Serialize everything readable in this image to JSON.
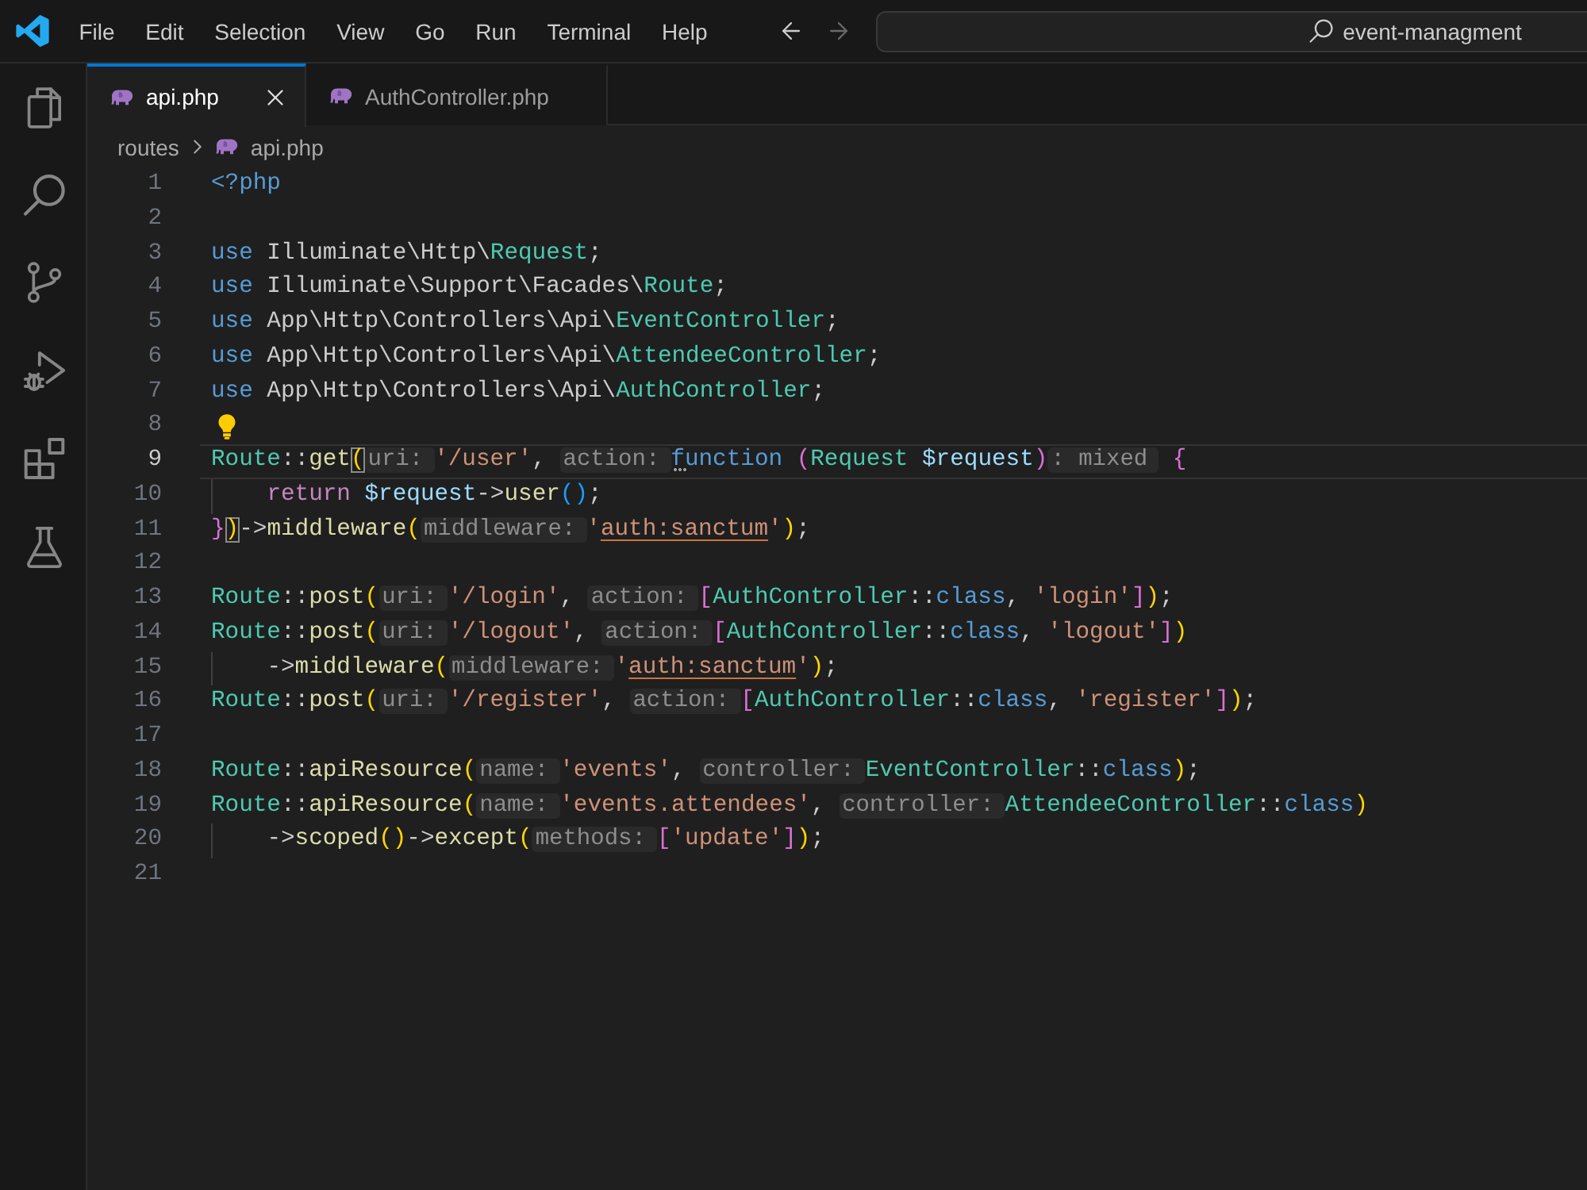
{
  "title_bar": {
    "menus": [
      "File",
      "Edit",
      "Selection",
      "View",
      "Go",
      "Run",
      "Terminal",
      "Help"
    ],
    "navigation": [
      {
        "kind": "back",
        "disabled": false
      },
      {
        "kind": "forward",
        "disabled": true
      }
    ],
    "command_center": {
      "text": "event-managment"
    }
  },
  "activity_bar": [
    {
      "kind": "explorer",
      "selected": false
    },
    {
      "kind": "search",
      "selected": false
    },
    {
      "kind": "source_control",
      "selected": false
    },
    {
      "kind": "run_debug",
      "selected": false
    },
    {
      "kind": "extensions",
      "selected": false
    },
    {
      "kind": "testing",
      "selected": false
    }
  ],
  "tabs": [
    {
      "label": "api.php",
      "selected": true
    },
    {
      "label": "AuthController.php",
      "selected": false
    }
  ],
  "breadcrumb": [
    {
      "label": "routes",
      "kind": "folder"
    },
    {
      "label": "api.php",
      "kind": "file"
    }
  ],
  "editor": {
    "lines": [
      {
        "number": "1",
        "current": false,
        "indented": false,
        "tokens": [
          {
            "kind": "keyword",
            "text": "<?php"
          }
        ]
      },
      {
        "number": "2",
        "current": false,
        "indented": false
      },
      {
        "number": "3",
        "current": false,
        "indented": false,
        "tokens": [
          {
            "kind": "keyword",
            "text": "use"
          },
          {
            "kind": "plain",
            "text": " Illuminate\\Http\\"
          },
          {
            "kind": "type",
            "text": "Request"
          },
          {
            "kind": "plain",
            "text": ";"
          }
        ]
      },
      {
        "number": "4",
        "current": false,
        "indented": false,
        "tokens": [
          {
            "kind": "keyword",
            "text": "use"
          },
          {
            "kind": "plain",
            "text": " Illuminate\\Support\\Facades\\"
          },
          {
            "kind": "type",
            "text": "Route"
          },
          {
            "kind": "plain",
            "text": ";"
          }
        ]
      },
      {
        "number": "5",
        "current": false,
        "indented": false,
        "tokens": [
          {
            "kind": "keyword",
            "text": "use"
          },
          {
            "kind": "plain",
            "text": " App\\Http\\Controllers\\Api\\"
          },
          {
            "kind": "type",
            "text": "EventController"
          },
          {
            "kind": "plain",
            "text": ";"
          }
        ]
      },
      {
        "number": "6",
        "current": false,
        "indented": false,
        "tokens": [
          {
            "kind": "keyword",
            "text": "use"
          },
          {
            "kind": "plain",
            "text": " App\\Http\\Controllers\\Api\\"
          },
          {
            "kind": "type",
            "text": "AttendeeController"
          },
          {
            "kind": "plain",
            "text": ";"
          }
        ]
      },
      {
        "number": "7",
        "current": false,
        "indented": false,
        "tokens": [
          {
            "kind": "keyword",
            "text": "use"
          },
          {
            "kind": "plain",
            "text": " App\\Http\\Controllers\\Api\\"
          },
          {
            "kind": "type",
            "text": "AuthController"
          },
          {
            "kind": "plain",
            "text": ";"
          }
        ]
      },
      {
        "number": "8",
        "current": false,
        "indented": false,
        "tokens": [
          {
            "kind": "lightbulb"
          }
        ]
      },
      {
        "number": "9",
        "current": true,
        "indented": false,
        "tokens": [
          {
            "kind": "type",
            "text": "Route"
          },
          {
            "kind": "plain",
            "text": "::"
          },
          {
            "kind": "method",
            "text": "get"
          },
          {
            "kind": "matched",
            "text": "("
          },
          {
            "kind": "hint",
            "text": "uri:"
          },
          {
            "kind": "string",
            "text": "'/user'"
          },
          {
            "kind": "plain",
            "text": ", "
          },
          {
            "kind": "hint",
            "text": "action:"
          },
          {
            "kind": "hinted",
            "text": "function"
          },
          {
            "kind": "bracket2",
            "text": " ("
          },
          {
            "kind": "type",
            "text": "Request"
          },
          {
            "kind": "variable",
            "text": " $request"
          },
          {
            "kind": "bracket2",
            "text": ")"
          },
          {
            "kind": "hint",
            "text": ": mixed"
          },
          {
            "kind": "bracket2",
            "text": " {"
          }
        ]
      },
      {
        "number": "10",
        "current": false,
        "indented": true,
        "tokens": [
          {
            "kind": "control",
            "text": "return"
          },
          {
            "kind": "variable",
            "text": " $request"
          },
          {
            "kind": "plain",
            "text": "->"
          },
          {
            "kind": "method",
            "text": "user"
          },
          {
            "kind": "bracket3",
            "text": "()"
          },
          {
            "kind": "plain",
            "text": ";"
          }
        ]
      },
      {
        "number": "11",
        "current": false,
        "indented": false,
        "tokens": [
          {
            "kind": "bracket2",
            "text": "}"
          },
          {
            "kind": "matched",
            "text": ")"
          },
          {
            "kind": "plain",
            "text": "->"
          },
          {
            "kind": "method",
            "text": "middleware"
          },
          {
            "kind": "bracket1",
            "text": "("
          },
          {
            "kind": "hint",
            "text": "middleware:"
          },
          {
            "kind": "string",
            "text": "'"
          },
          {
            "kind": "link",
            "text": "auth:sanctum"
          },
          {
            "kind": "string",
            "text": "'"
          },
          {
            "kind": "bracket1",
            "text": ")"
          },
          {
            "kind": "plain",
            "text": ";"
          }
        ]
      },
      {
        "number": "12",
        "current": false,
        "indented": false
      },
      {
        "number": "13",
        "current": false,
        "indented": false,
        "tokens": [
          {
            "kind": "type",
            "text": "Route"
          },
          {
            "kind": "plain",
            "text": "::"
          },
          {
            "kind": "method",
            "text": "post"
          },
          {
            "kind": "bracket1",
            "text": "("
          },
          {
            "kind": "hint",
            "text": "uri:"
          },
          {
            "kind": "string",
            "text": "'/login'"
          },
          {
            "kind": "plain",
            "text": ", "
          },
          {
            "kind": "hint",
            "text": "action:"
          },
          {
            "kind": "bracket2",
            "text": "["
          },
          {
            "kind": "type",
            "text": "AuthController"
          },
          {
            "kind": "plain",
            "text": "::"
          },
          {
            "kind": "keyword",
            "text": "class"
          },
          {
            "kind": "plain",
            "text": ", "
          },
          {
            "kind": "string",
            "text": "'login'"
          },
          {
            "kind": "bracket2",
            "text": "]"
          },
          {
            "kind": "bracket1",
            "text": ")"
          },
          {
            "kind": "plain",
            "text": ";"
          }
        ]
      },
      {
        "number": "14",
        "current": false,
        "indented": false,
        "tokens": [
          {
            "kind": "type",
            "text": "Route"
          },
          {
            "kind": "plain",
            "text": "::"
          },
          {
            "kind": "method",
            "text": "post"
          },
          {
            "kind": "bracket1",
            "text": "("
          },
          {
            "kind": "hint",
            "text": "uri:"
          },
          {
            "kind": "string",
            "text": "'/logout'"
          },
          {
            "kind": "plain",
            "text": ", "
          },
          {
            "kind": "hint",
            "text": "action:"
          },
          {
            "kind": "bracket2",
            "text": "["
          },
          {
            "kind": "type",
            "text": "AuthController"
          },
          {
            "kind": "plain",
            "text": "::"
          },
          {
            "kind": "keyword",
            "text": "class"
          },
          {
            "kind": "plain",
            "text": ", "
          },
          {
            "kind": "string",
            "text": "'logout'"
          },
          {
            "kind": "bracket2",
            "text": "]"
          },
          {
            "kind": "bracket1",
            "text": ")"
          }
        ]
      },
      {
        "number": "15",
        "current": false,
        "indented": true,
        "tokens": [
          {
            "kind": "plain",
            "text": "->"
          },
          {
            "kind": "method",
            "text": "middleware"
          },
          {
            "kind": "bracket1",
            "text": "("
          },
          {
            "kind": "hint",
            "text": "middleware:"
          },
          {
            "kind": "string",
            "text": "'"
          },
          {
            "kind": "link",
            "text": "auth:sanctum"
          },
          {
            "kind": "string",
            "text": "'"
          },
          {
            "kind": "bracket1",
            "text": ")"
          },
          {
            "kind": "plain",
            "text": ";"
          }
        ]
      },
      {
        "number": "16",
        "current": false,
        "indented": false,
        "tokens": [
          {
            "kind": "type",
            "text": "Route"
          },
          {
            "kind": "plain",
            "text": "::"
          },
          {
            "kind": "method",
            "text": "post"
          },
          {
            "kind": "bracket1",
            "text": "("
          },
          {
            "kind": "hint",
            "text": "uri:"
          },
          {
            "kind": "string",
            "text": "'/register'"
          },
          {
            "kind": "plain",
            "text": ", "
          },
          {
            "kind": "hint",
            "text": "action:"
          },
          {
            "kind": "bracket2",
            "text": "["
          },
          {
            "kind": "type",
            "text": "AuthController"
          },
          {
            "kind": "plain",
            "text": "::"
          },
          {
            "kind": "keyword",
            "text": "class"
          },
          {
            "kind": "plain",
            "text": ", "
          },
          {
            "kind": "string",
            "text": "'register'"
          },
          {
            "kind": "bracket2",
            "text": "]"
          },
          {
            "kind": "bracket1",
            "text": ")"
          },
          {
            "kind": "plain",
            "text": ";"
          }
        ]
      },
      {
        "number": "17",
        "current": false,
        "indented": false
      },
      {
        "number": "18",
        "current": false,
        "indented": false,
        "tokens": [
          {
            "kind": "type",
            "text": "Route"
          },
          {
            "kind": "plain",
            "text": "::"
          },
          {
            "kind": "method",
            "text": "apiResource"
          },
          {
            "kind": "bracket1",
            "text": "("
          },
          {
            "kind": "hint",
            "text": "name:"
          },
          {
            "kind": "string",
            "text": "'events'"
          },
          {
            "kind": "plain",
            "text": ", "
          },
          {
            "kind": "hint",
            "text": "controller:"
          },
          {
            "kind": "type",
            "text": "EventController"
          },
          {
            "kind": "plain",
            "text": "::"
          },
          {
            "kind": "keyword",
            "text": "class"
          },
          {
            "kind": "bracket1",
            "text": ")"
          },
          {
            "kind": "plain",
            "text": ";"
          }
        ]
      },
      {
        "number": "19",
        "current": false,
        "indented": false,
        "tokens": [
          {
            "kind": "type",
            "text": "Route"
          },
          {
            "kind": "plain",
            "text": "::"
          },
          {
            "kind": "method",
            "text": "apiResource"
          },
          {
            "kind": "bracket1",
            "text": "("
          },
          {
            "kind": "hint",
            "text": "name:"
          },
          {
            "kind": "string",
            "text": "'events.attendees'"
          },
          {
            "kind": "plain",
            "text": ", "
          },
          {
            "kind": "hint",
            "text": "controller:"
          },
          {
            "kind": "type",
            "text": "AttendeeController"
          },
          {
            "kind": "plain",
            "text": "::"
          },
          {
            "kind": "keyword",
            "text": "class"
          },
          {
            "kind": "bracket1",
            "text": ")"
          }
        ]
      },
      {
        "number": "20",
        "current": false,
        "indented": true,
        "tokens": [
          {
            "kind": "plain",
            "text": "->"
          },
          {
            "kind": "method",
            "text": "scoped"
          },
          {
            "kind": "bracket1",
            "text": "()"
          },
          {
            "kind": "plain",
            "text": "->"
          },
          {
            "kind": "method",
            "text": "except"
          },
          {
            "kind": "bracket1",
            "text": "("
          },
          {
            "kind": "hint",
            "text": "methods:"
          },
          {
            "kind": "bracket2",
            "text": "["
          },
          {
            "kind": "string",
            "text": "'update'"
          },
          {
            "kind": "bracket2",
            "text": "]"
          },
          {
            "kind": "bracket1",
            "text": ")"
          },
          {
            "kind": "plain",
            "text": ";"
          }
        ]
      },
      {
        "number": "21",
        "current": false,
        "indented": false
      }
    ]
  }
}
